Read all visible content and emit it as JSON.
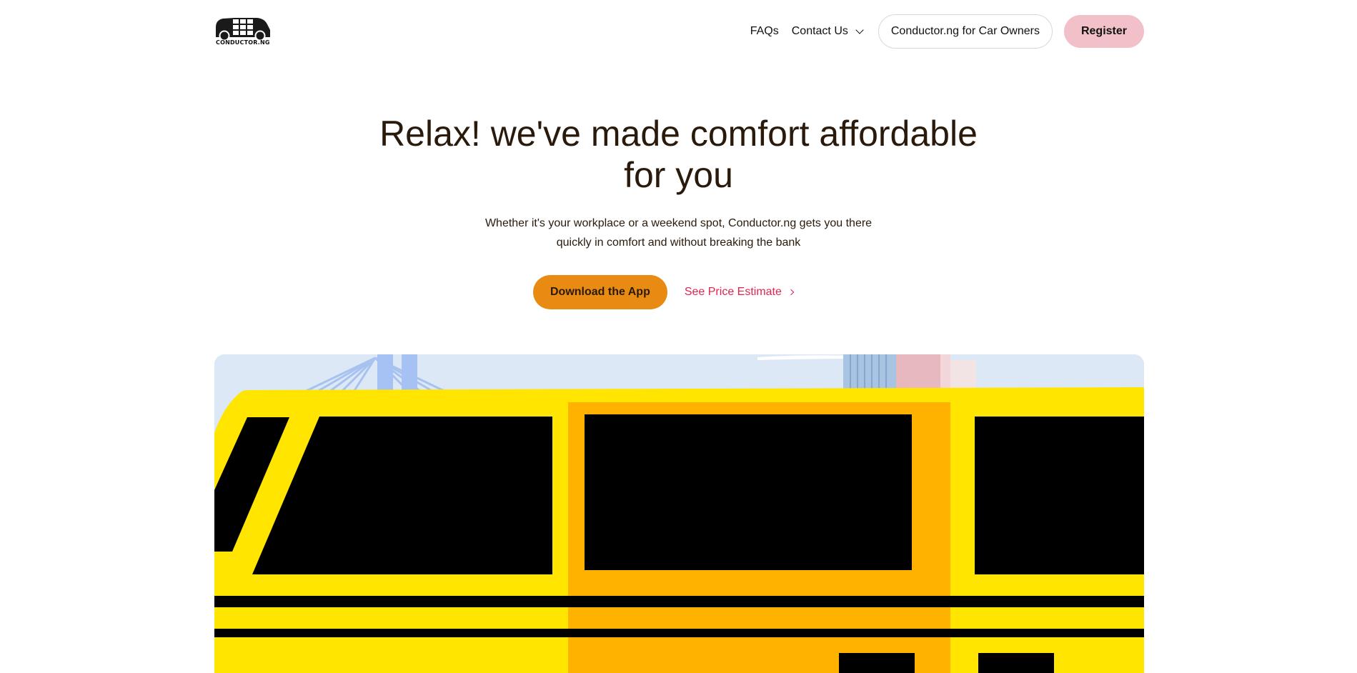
{
  "logo": {
    "name": "CONDUCTOR.NG",
    "grid_letters": [
      "CON",
      "DUC",
      "TOR"
    ]
  },
  "nav": {
    "faqs": "FAQs",
    "contact": "Contact Us",
    "owners": "Conductor.ng for Car Owners",
    "register": "Register"
  },
  "hero": {
    "title_line1": "Relax! we've made comfort affordable",
    "title_line2": "for you",
    "subtitle_line1": "Whether it's your workplace or a weekend spot, Conductor.ng gets you there",
    "subtitle_line2": "quickly in comfort and without breaking the bank",
    "download": "Download the App",
    "price": "See Price Estimate"
  },
  "colors": {
    "text": "#2a1a0b",
    "download_bg": "#e98b13",
    "register_bg": "#f2c0c8",
    "link": "#e0254d",
    "bus_yellow": "#ffe500",
    "bus_orange": "#ffb300",
    "sky": "#dce8f6"
  },
  "icons": {
    "contact_dropdown": "chevron-down-icon",
    "price_link": "chevron-right-icon"
  }
}
